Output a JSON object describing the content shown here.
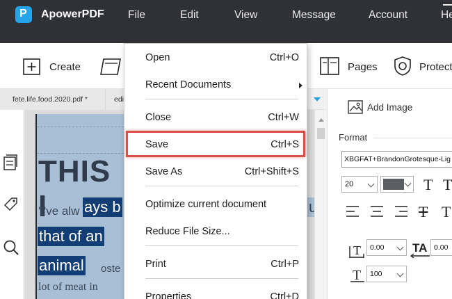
{
  "app": {
    "name": "ApowerPDF",
    "accent": "#27a4e8"
  },
  "menubar": {
    "items": [
      "File",
      "Edit",
      "View",
      "Message",
      "Account",
      "He"
    ]
  },
  "toolbar": {
    "create_label": "Create",
    "pages_label": "Pages",
    "protect_label": "Protect"
  },
  "tabs": {
    "active": "fete.life.food.2020.pdf *",
    "second": "edi"
  },
  "file_menu": {
    "items": [
      {
        "label": "Open",
        "shortcut": "Ctrl+O"
      },
      {
        "label": "Recent Documents",
        "shortcut": ""
      },
      {
        "label": "Close",
        "shortcut": "Ctrl+W"
      },
      {
        "label": "Save",
        "shortcut": "Ctrl+S"
      },
      {
        "label": "Save As",
        "shortcut": "Ctrl+Shift+S"
      },
      {
        "label": "Optimize current document",
        "shortcut": ""
      },
      {
        "label": "Reduce File Size...",
        "shortcut": ""
      },
      {
        "label": "Print",
        "shortcut": "Ctrl+P"
      },
      {
        "label": "Properties",
        "shortcut": "Ctrl+D"
      }
    ],
    "highlight_color": "#d9524a"
  },
  "document": {
    "title_text": "THIS I",
    "quote_text": "'I've alw",
    "highlight_lines": [
      "ays b",
      "that of an",
      "animal"
    ],
    "tail_text": "ut",
    "small_lines": [
      "oste",
      "lot of meat in"
    ]
  },
  "properties": {
    "add_image_label": "Add Image",
    "format_label": "Format",
    "font_name": "XBGFAT+BrandonGrotesque-Lig",
    "font_size": "20",
    "text_color": "#5b5f64",
    "char_spacing": "0.00",
    "word_spacing": "0.00",
    "scale": "100"
  }
}
